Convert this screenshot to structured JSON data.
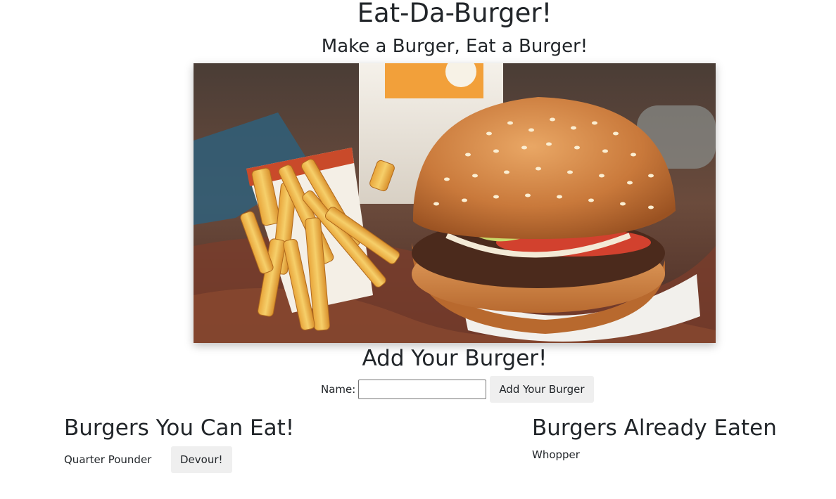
{
  "header": {
    "title": "Eat-Da-Burger!",
    "subtitle": "Make a Burger, Eat a Burger!"
  },
  "hero_image": {
    "description_icon": "burger-and-fries-photo"
  },
  "add_form": {
    "heading": "Add Your Burger!",
    "name_label": "Name:",
    "name_value": "",
    "submit_label": "Add Your Burger"
  },
  "uneaten": {
    "heading": "Burgers You Can Eat!",
    "items": [
      {
        "name": "Quarter Pounder",
        "action_label": "Devour!"
      }
    ]
  },
  "eaten": {
    "heading": "Burgers Already Eaten",
    "items": [
      {
        "name": "Whopper"
      }
    ]
  }
}
